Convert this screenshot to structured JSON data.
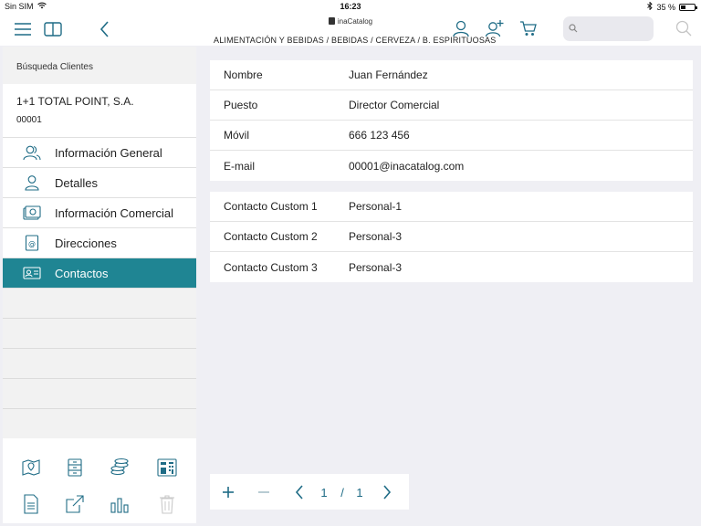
{
  "status": {
    "carrier": "Sin SIM",
    "time": "16:23",
    "battery": "35 %",
    "battery_level": 0.35
  },
  "app": {
    "logo": "inaCatalog"
  },
  "toolbar": {
    "breadcrumb": "ALIMENTACIÓN Y BEBIDAS / BEBIDAS / CERVEZA / B. ESPIRITUOSAS",
    "search_value": "",
    "icons": [
      "menu-icon",
      "split-view-icon",
      "back-icon",
      "user-icon",
      "add-user-icon",
      "cart-icon",
      "search-icon"
    ]
  },
  "sidebar": {
    "title": "Búsqueda Clientes",
    "client_name": "1+1 TOTAL POINT, S.A.",
    "client_code": "00001",
    "items": [
      {
        "label": "Información General",
        "icon": "users-icon"
      },
      {
        "label": "Detalles",
        "icon": "person-icon"
      },
      {
        "label": "Información Comercial",
        "icon": "money-icon"
      },
      {
        "label": "Direcciones",
        "icon": "address-book-icon"
      },
      {
        "label": "Contactos",
        "icon": "contact-card-icon",
        "active": true
      }
    ],
    "tools": [
      "map-icon",
      "archive-icon",
      "coins-icon",
      "calculator-icon",
      "document-icon",
      "export-icon",
      "bar-chart-icon",
      "trash-icon"
    ]
  },
  "contact": {
    "fields": [
      {
        "label": "Nombre",
        "value": "Juan Fernández"
      },
      {
        "label": "Puesto",
        "value": "Director Comercial"
      },
      {
        "label": "Móvil",
        "value": "666 123 456"
      },
      {
        "label": "E-mail",
        "value": "00001@inacatalog.com"
      }
    ],
    "custom": [
      {
        "label": "Contacto Custom 1",
        "value": "Personal-1"
      },
      {
        "label": "Contacto Custom 2",
        "value": "Personal-3"
      },
      {
        "label": "Contacto Custom 3",
        "value": "Personal-3"
      }
    ]
  },
  "pager": {
    "current": "1",
    "separator": "/",
    "total": "1"
  },
  "colors": {
    "accent": "#1f8593",
    "icon": "#1f6c86"
  }
}
